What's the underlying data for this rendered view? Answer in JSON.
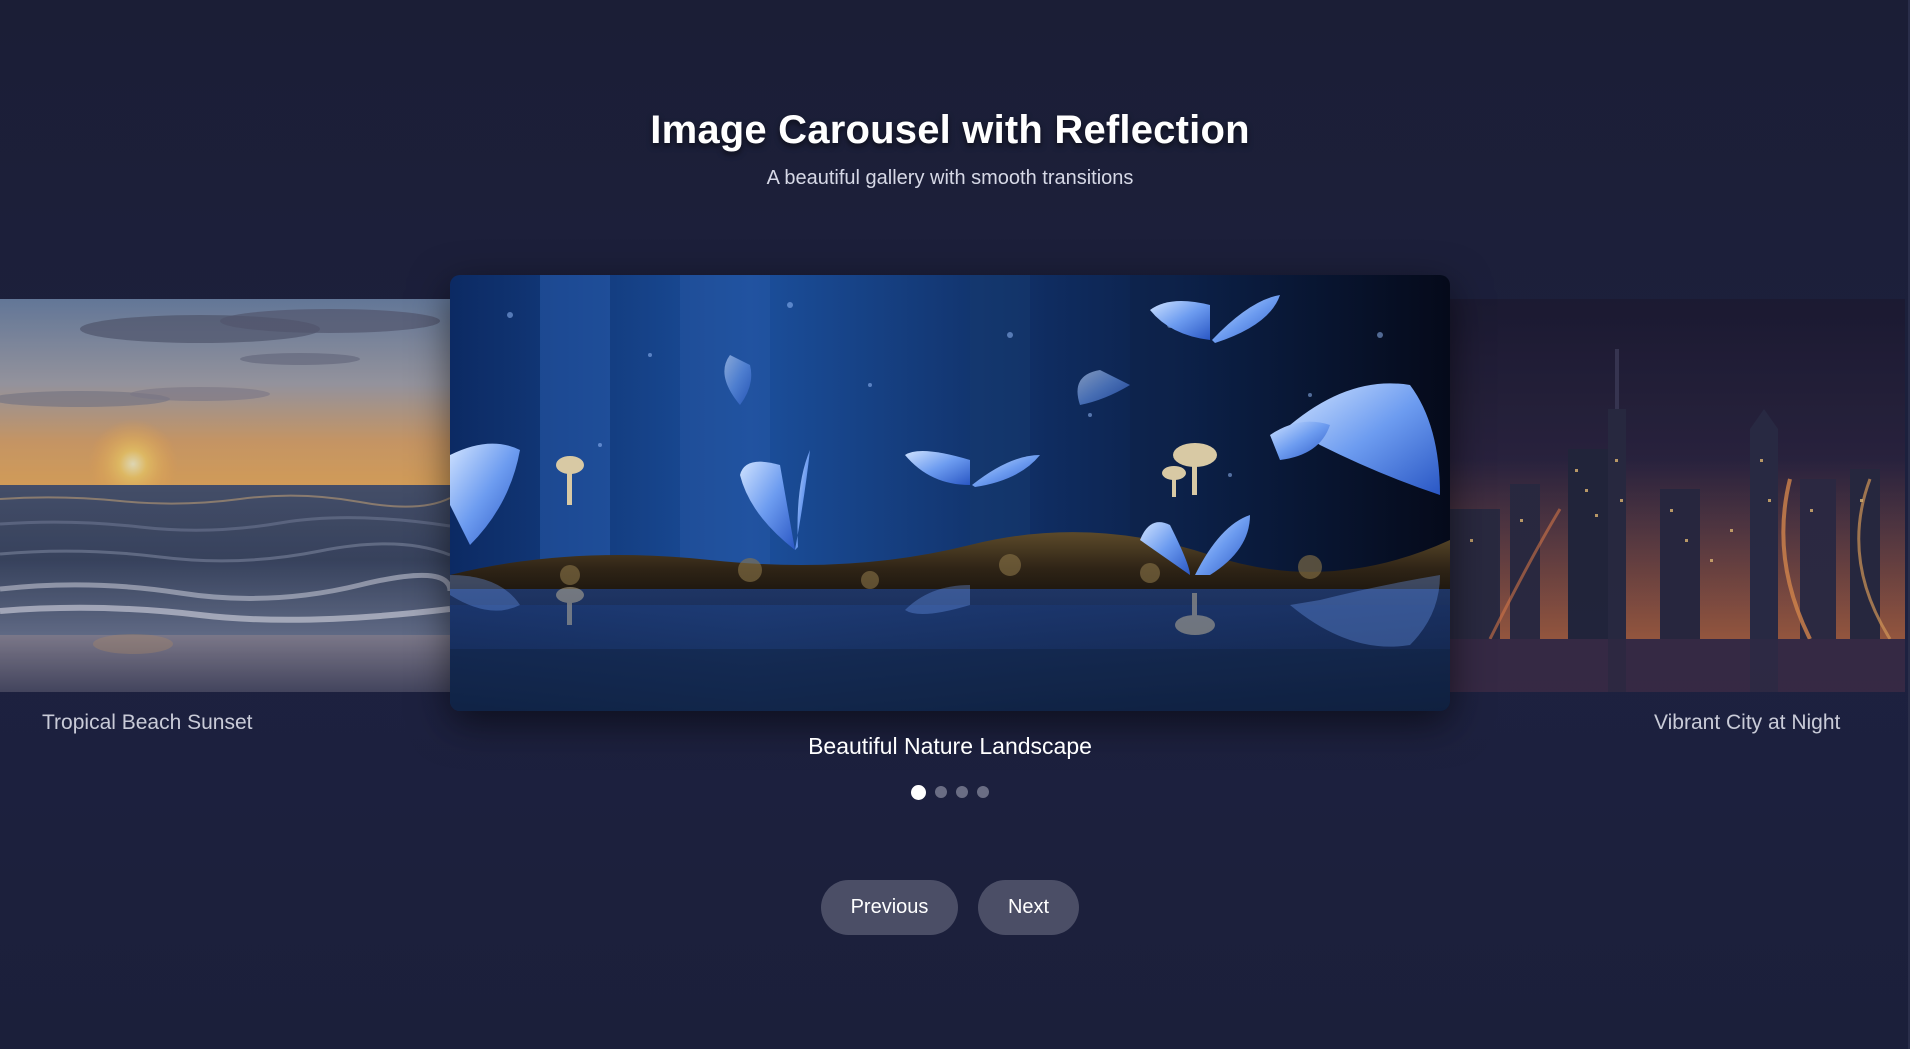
{
  "header": {
    "title": "Image Carousel with Reflection",
    "subtitle": "A beautiful gallery with smooth transitions"
  },
  "slides": [
    {
      "caption": "Beautiful Nature Landscape",
      "scene": "butterflies-mushrooms-forest"
    },
    {
      "caption": "Tropical Beach Sunset",
      "scene": "beach-sunset"
    },
    {
      "caption": "Vibrant City at Night",
      "scene": "city-night"
    }
  ],
  "pagination": {
    "count": 4,
    "active_index": 0
  },
  "controls": {
    "prev_label": "Previous",
    "next_label": "Next"
  },
  "colors": {
    "background": "#1c1f38",
    "button": "#4b4e66",
    "dot_inactive": "#6a6d84",
    "dot_active": "#ffffff"
  }
}
